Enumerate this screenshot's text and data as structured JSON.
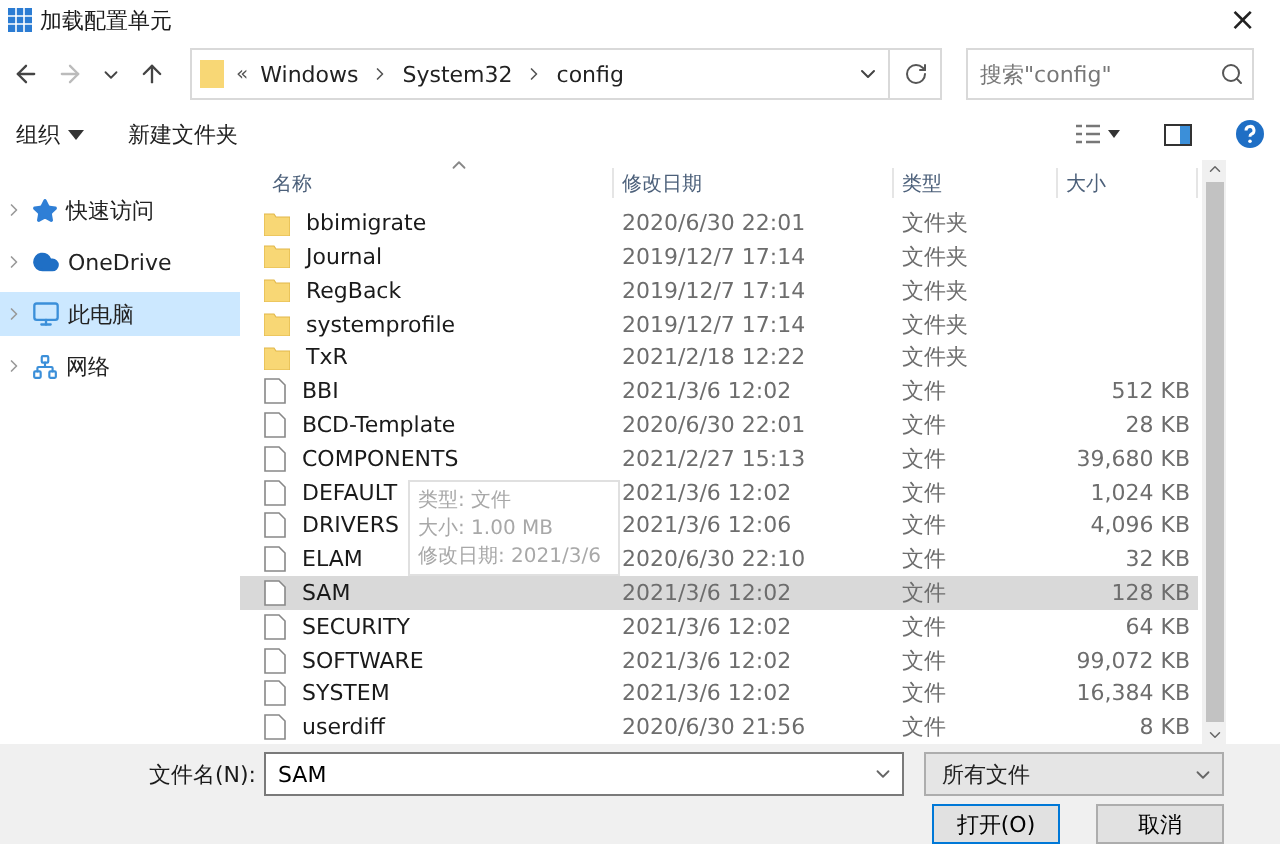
{
  "window": {
    "title": "加载配置单元",
    "close": "×"
  },
  "address": {
    "path": [
      "Windows",
      "System32",
      "config"
    ],
    "overflow": "«",
    "search_placeholder": "搜索\"config\""
  },
  "toolbar": {
    "organize": "组织",
    "new_folder": "新建文件夹"
  },
  "sidebar": {
    "items": [
      {
        "label": "快速访问",
        "selected": false
      },
      {
        "label": "OneDrive",
        "selected": false
      },
      {
        "label": "此电脑",
        "selected": true
      },
      {
        "label": "网络",
        "selected": false
      }
    ]
  },
  "table": {
    "columns": [
      "名称",
      "修改日期",
      "类型",
      "大小"
    ],
    "rows": [
      {
        "name": "bbimigrate",
        "date": "2020/6/30 22:01",
        "type": "文件夹",
        "size": "",
        "kind": "folder",
        "selected": false
      },
      {
        "name": "Journal",
        "date": "2019/12/7 17:14",
        "type": "文件夹",
        "size": "",
        "kind": "folder",
        "selected": false
      },
      {
        "name": "RegBack",
        "date": "2019/12/7 17:14",
        "type": "文件夹",
        "size": "",
        "kind": "folder",
        "selected": false
      },
      {
        "name": "systemprofile",
        "date": "2019/12/7 17:14",
        "type": "文件夹",
        "size": "",
        "kind": "folder",
        "selected": false
      },
      {
        "name": "TxR",
        "date": "2021/2/18 12:22",
        "type": "文件夹",
        "size": "",
        "kind": "folder",
        "selected": false
      },
      {
        "name": "BBI",
        "date": "2021/3/6 12:02",
        "type": "文件",
        "size": "512 KB",
        "kind": "file",
        "selected": false
      },
      {
        "name": "BCD-Template",
        "date": "2020/6/30 22:01",
        "type": "文件",
        "size": "28 KB",
        "kind": "file",
        "selected": false
      },
      {
        "name": "COMPONENTS",
        "date": "2021/2/27 15:13",
        "type": "文件",
        "size": "39,680 KB",
        "kind": "file",
        "selected": false
      },
      {
        "name": "DEFAULT",
        "date": "2021/3/6 12:02",
        "type": "文件",
        "size": "1,024 KB",
        "kind": "file",
        "selected": false
      },
      {
        "name": "DRIVERS",
        "date": "2021/3/6 12:06",
        "type": "文件",
        "size": "4,096 KB",
        "kind": "file",
        "selected": false
      },
      {
        "name": "ELAM",
        "date": "2020/6/30 22:10",
        "type": "文件",
        "size": "32 KB",
        "kind": "file",
        "selected": false
      },
      {
        "name": "SAM",
        "date": "2021/3/6 12:02",
        "type": "文件",
        "size": "128 KB",
        "kind": "file",
        "selected": true
      },
      {
        "name": "SECURITY",
        "date": "2021/3/6 12:02",
        "type": "文件",
        "size": "64 KB",
        "kind": "file",
        "selected": false
      },
      {
        "name": "SOFTWARE",
        "date": "2021/3/6 12:02",
        "type": "文件",
        "size": "99,072 KB",
        "kind": "file",
        "selected": false
      },
      {
        "name": "SYSTEM",
        "date": "2021/3/6 12:02",
        "type": "文件",
        "size": "16,384 KB",
        "kind": "file",
        "selected": false
      },
      {
        "name": "userdiff",
        "date": "2020/6/30 21:56",
        "type": "文件",
        "size": "8 KB",
        "kind": "file",
        "selected": false
      }
    ]
  },
  "tooltip": {
    "lines": [
      "类型: 文件",
      "大小: 1.00 MB",
      "修改日期: 2021/3/6"
    ]
  },
  "footer": {
    "filename_label": "文件名(N):",
    "filename_value": "SAM",
    "filter": "所有文件",
    "open": "打开(O)",
    "cancel": "取消"
  }
}
